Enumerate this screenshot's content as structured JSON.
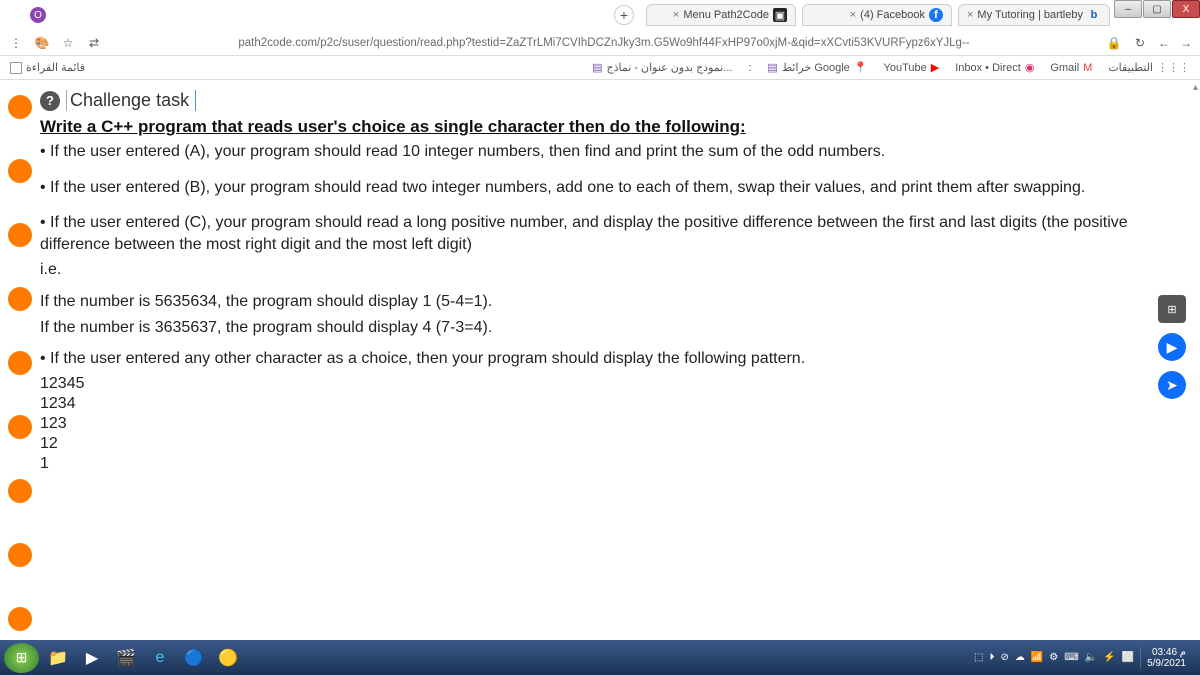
{
  "window": {
    "min": "–",
    "max": "▢",
    "close": "X"
  },
  "tabs": {
    "new": "+",
    "items": [
      {
        "label": "Menu Path2Code",
        "icon": "▣",
        "x": "×"
      },
      {
        "label": "(4) Facebook",
        "icon": "f",
        "x": "×"
      },
      {
        "label": "My Tutoring | bartleby",
        "icon": "b",
        "x": "×"
      }
    ]
  },
  "addr": {
    "menu": "⋮",
    "paint": "🎨",
    "star": "☆",
    "trans": "⇄",
    "url": "path2code.com/p2c/suser/question/read.php?testid=ZaZTrLMi7CVIhDCZnJky3m.G5Wo9hf44FxHP97o0xjM-&qid=xXCvti53KVURFypz6xYJLg--",
    "lock": "🔒",
    "reload": "↻",
    "back": "←",
    "fwd": "→"
  },
  "bookmarks": {
    "readlist": "قائمة القراءة",
    "apps": "التطبيقات",
    "gmail": "Gmail",
    "inbox": "Inbox • Direct",
    "youtube": "YouTube",
    "maps": "خرائط Google",
    "form": "نموذج بدون عنوان - نماذج..."
  },
  "challenge": {
    "title": "Challenge task",
    "prompt": "Write a C++ program that reads user's choice as single character then do the following:",
    "a": "• If the user entered (A), your program should read 10 integer numbers, then find and print the sum of the odd numbers.",
    "b": "• If the user entered (B), your program should read two integer numbers, add one to each of them, swap their values, and print them after swapping.",
    "c": "• If the user entered (C), your program should read a long positive number, and display the positive difference between the first and last digits (the positive difference between the most right digit and the most left digit)",
    "ie": "i.e.",
    "ex1": "If the number is 5635634, the program should display 1 (5-4=1).",
    "ex2": "If the number is 3635637, the program should display 4 (7-3=4).",
    "other": "• If the user entered any other character as a choice, then your program should display the following pattern.",
    "pattern": [
      "12345",
      "1234",
      "123",
      "12",
      "1"
    ]
  },
  "float": {
    "grid": "⊞",
    "play": "▶",
    "send": "➤"
  },
  "tray": {
    "icons": [
      "⬚",
      "⏵",
      "⊘",
      "☁",
      "📶",
      "⚙",
      "⌨",
      "🔈",
      "⚡",
      "⬜"
    ],
    "time": "03:46 م",
    "date": "5/9/2021"
  }
}
